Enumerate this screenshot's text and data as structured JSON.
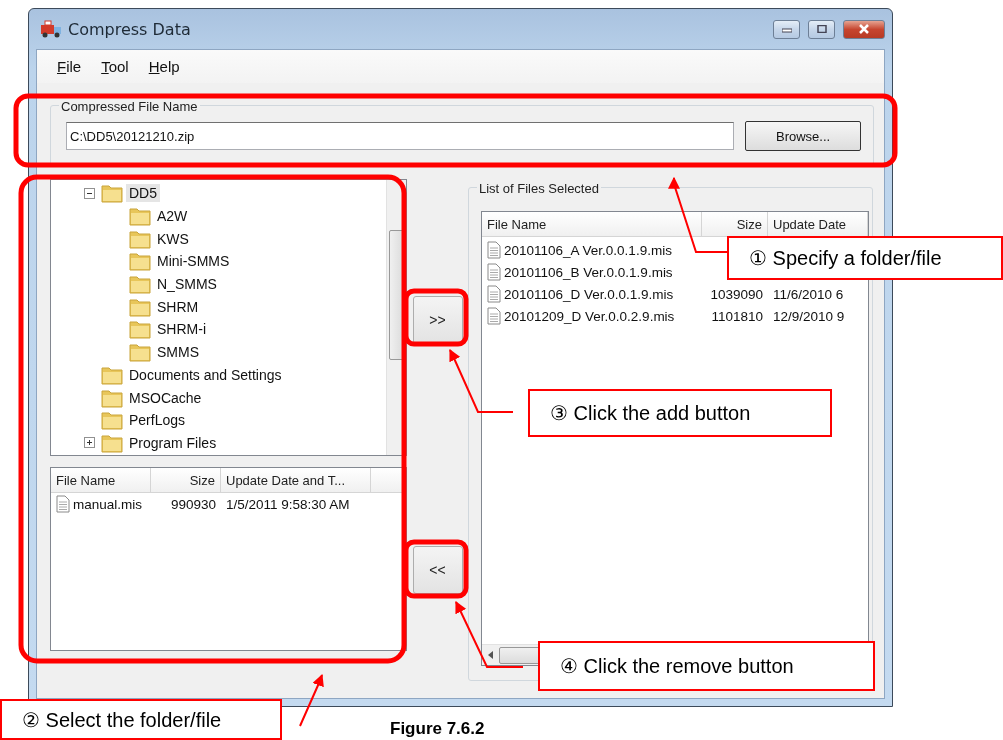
{
  "window": {
    "title": "Compress Data"
  },
  "menu": [
    "File",
    "Tool",
    "Help"
  ],
  "compressed_file": {
    "legend": "Compressed File Name",
    "value": "C:\\DD5\\20121210.zip",
    "browse_button": "Browse..."
  },
  "folder_tree": [
    {
      "label": "DD5",
      "expandable": true,
      "expanded": true,
      "selected": true,
      "children": [
        {
          "label": "A2W",
          "selected": false
        },
        {
          "label": "KWS",
          "selected": false
        },
        {
          "label": "Mini-SMMS",
          "selected": false
        },
        {
          "label": "N_SMMS",
          "selected": false
        },
        {
          "label": "SHRM",
          "selected": false
        },
        {
          "label": "SHRM-i",
          "selected": false
        },
        {
          "label": "SMMS",
          "selected": false
        }
      ]
    },
    {
      "label": "Documents and Settings",
      "expandable": false,
      "selected": false
    },
    {
      "label": "MSOCache",
      "expandable": false,
      "selected": false
    },
    {
      "label": "PerfLogs",
      "expandable": false,
      "selected": false
    },
    {
      "label": "Program Files",
      "expandable": true,
      "expanded": false,
      "selected": false
    }
  ],
  "file_list": {
    "columns": [
      "File Name",
      "Size",
      "Update Date and T..."
    ],
    "rows": [
      {
        "name": "manual.mis",
        "size": "990930",
        "date": "1/5/2011 9:58:30 AM"
      }
    ]
  },
  "add_button": ">>",
  "remove_button": "<<",
  "selected_files": {
    "legend": "List of Files Selected",
    "columns": [
      "File Name",
      "Size",
      "Update Date"
    ],
    "rows": [
      {
        "name": "20101106_A Ver.0.0.1.9.mis"
      },
      {
        "name": "20101106_B Ver.0.0.1.9.mis"
      },
      {
        "name": "20101106_D Ver.0.0.1.9.mis",
        "size": "1039090",
        "date": "11/6/2010 6"
      },
      {
        "name": "20101209_D Ver.0.0.2.9.mis",
        "size": "1101810",
        "date": "12/9/2010 9"
      }
    ]
  },
  "callouts": [
    "① Specify a folder/file",
    "② Select the folder/file",
    "③ Click the add button",
    "④ Click the remove button"
  ],
  "caption": "Figure 7.6.2"
}
